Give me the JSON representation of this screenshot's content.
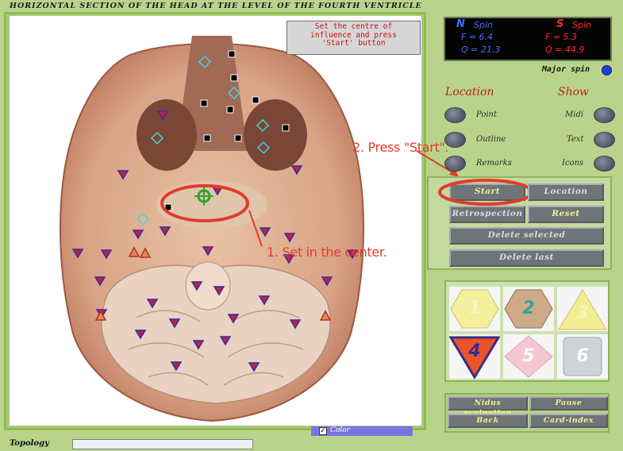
{
  "header": {
    "title": "HORIZONTAL SECTION OF THE HEAD AT THE LEVEL OF THE FOURTH VENTRICLE"
  },
  "instruction": {
    "line1": "Set the centre of",
    "line2": "influence and press",
    "line3": "'Start' button"
  },
  "annotations": {
    "step1": "1. Set in the center.",
    "step2": "2. Press \"Start\"."
  },
  "spin": {
    "n_label": "N",
    "n_unit": "Spin",
    "n_f": "F = 6.4",
    "n_q": "Q = 21.3",
    "s_label": "S",
    "s_unit": "Spin",
    "s_f": "F = 5.3",
    "s_q": "Q = 44.9",
    "major_label": "Major spin",
    "major_color": "#1b3fd6"
  },
  "location": {
    "title": "Location",
    "options": [
      "Point",
      "Outline",
      "Remarks"
    ]
  },
  "show": {
    "title": "Show",
    "options": [
      "Midi",
      "Text",
      "Icons"
    ]
  },
  "controls": {
    "start": "Start",
    "location": "Location",
    "retrospection": "Retrospection",
    "reset": "Reset",
    "delete_selected": "Delete selected",
    "delete_last": "Delete last"
  },
  "symbols": [
    {
      "label": "1",
      "shape": "hexagon",
      "color": "#f3ef9a"
    },
    {
      "label": "2",
      "shape": "hexagon",
      "color": "#cfaa88"
    },
    {
      "label": "3",
      "shape": "triangle-up",
      "color": "#f2ed8f"
    },
    {
      "label": "4",
      "shape": "triangle-down",
      "color": "#e9542a",
      "selected": true
    },
    {
      "label": "5",
      "shape": "diamond",
      "color": "#f5c7d3"
    },
    {
      "label": "6",
      "shape": "square",
      "color": "#cfd3d6"
    }
  ],
  "bottom": {
    "nidus": "Nidus evaluation",
    "pause": "Pause",
    "back": "Back",
    "card_index": "Card-index"
  },
  "footer": {
    "topology_label": "Topology",
    "color_label": "Color"
  },
  "colors": {
    "accent_red": "#e23b2c",
    "panel_green": "#b9d48a",
    "button_gray": "#6f7478"
  }
}
